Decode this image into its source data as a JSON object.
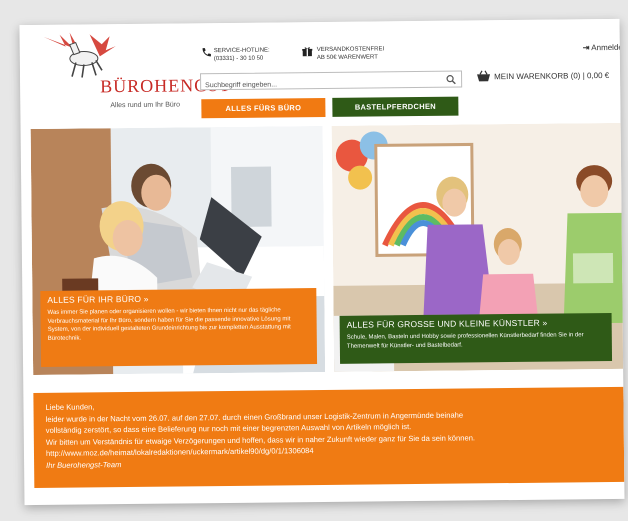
{
  "header": {
    "logo_word": "BÜROHENGST",
    "logo_reg": "®",
    "tagline": "Alles rund um Ihr Büro",
    "hotline_label": "SERVICE-HOTLINE:",
    "hotline_number": "(03331) - 30 10 50",
    "shipping_line1": "VERSANDKOSTENFREI",
    "shipping_line2": "AB 50€ WARENWERT",
    "login_label": "Anmelden",
    "search_placeholder": "Suchbegriff eingeben...",
    "cart_label": "MEIN WARENKORB (0) | 0,00 €"
  },
  "nav": {
    "tab_office": "ALLES FÜRS BÜRO",
    "tab_kids": "BASTELPFERDCHEN"
  },
  "banners": {
    "office": {
      "title": "ALLES FÜR IHR BÜRO »",
      "text": "Was immer Sie planen oder organisieren wollen - wir bieten Ihnen nicht nur das tägliche Verbrauchsmaterial für Ihr Büro, sondern haben für Sie die passende innovative Lösung mit System, von der individuell gestalteten Grundeinrichtung bis zur kompletten Ausstattung mit Bürotechnik."
    },
    "kids": {
      "title": "ALLES FÜR GROSSE UND KLEINE KÜNSTLER »",
      "text": "Schule, Malen, Basteln und Hobby sowie professionellen Künstlerbedarf finden Sie in der Themenwelt für Künstler- und Bastelbedarf."
    }
  },
  "notice": {
    "greeting": "Liebe Kunden,",
    "line1": "leider wurde in der Nacht vom 26.07. auf den 27.07. durch einen Großbrand unser Logistik-Zentrum in Angermünde beinahe",
    "line2": "vollständig zerstört, so dass eine Belieferung nur noch mit einer begrenzten Auswahl von Artikeln möglich ist.",
    "line3": "Wir bitten um Verständnis für etwaige Verzögerungen und hoffen, dass wir in naher Zukunft wieder ganz für Sie da sein können.",
    "link": "http://www.moz.de/heimat/lokalredaktionen/uckermark/artikel90/dg/0/1/1306084",
    "signature": "Ihr Buerohengst-Team"
  },
  "colors": {
    "orange": "#f17a12",
    "green": "#2f5a17",
    "brand_red": "#c72a25"
  },
  "icons": {
    "hotline": "phone-icon",
    "shipping": "gift-icon",
    "login": "login-arrow-icon",
    "search": "magnifier-icon",
    "cart": "shopping-basket-icon"
  }
}
